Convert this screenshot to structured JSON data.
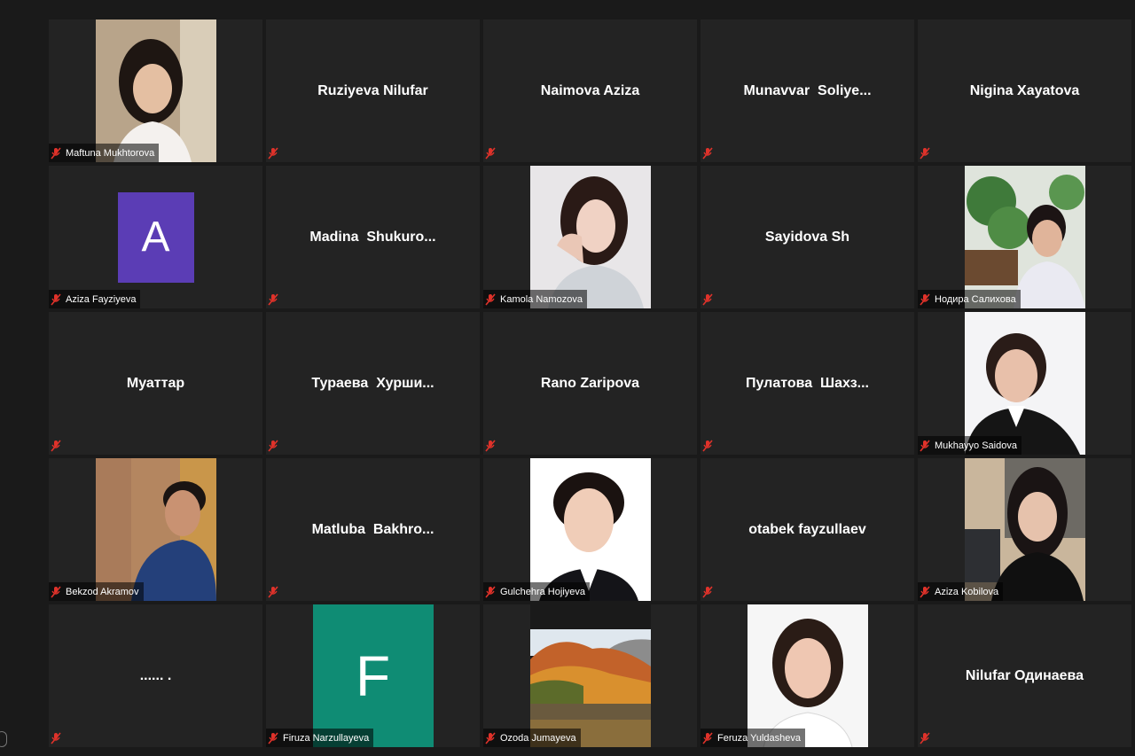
{
  "participants": [
    {
      "name": "Maftuna Mukhtorova",
      "center": "",
      "video": "woman-portrait-1"
    },
    {
      "name": "",
      "center": "Ruziyeva Nilufar"
    },
    {
      "name": "",
      "center": "Naimova Aziza"
    },
    {
      "name": "",
      "center": "Munavvar  Soliye..."
    },
    {
      "name": "",
      "center": "Nigina Xayatova"
    },
    {
      "name": "Aziza Fayziyeva",
      "center": "",
      "avatar_letter": "A",
      "avatar_color": "#5b3db5"
    },
    {
      "name": "",
      "center": "Madina  Shukuro..."
    },
    {
      "name": "Kamola Namozova",
      "center": "",
      "video": "woman-portrait-2"
    },
    {
      "name": "",
      "center": "Sayidova Sh"
    },
    {
      "name": "Нодира Салихова",
      "center": "",
      "video": "woman-portrait-3"
    },
    {
      "name": "",
      "center": "Муаттар"
    },
    {
      "name": "",
      "center": "Тураева  Хурши..."
    },
    {
      "name": "",
      "center": "Rano Zaripova"
    },
    {
      "name": "",
      "center": "Пулатова  Шахз..."
    },
    {
      "name": "Mukhayyo Saidova",
      "center": "",
      "video": "woman-portrait-4"
    },
    {
      "name": "Bekzod Akramov",
      "center": "",
      "video": "man-portrait"
    },
    {
      "name": "",
      "center": "Matluba  Bakhro..."
    },
    {
      "name": "Gulchehra Hojiyeva",
      "center": "",
      "video": "woman-portrait-5"
    },
    {
      "name": "",
      "center": "otabek fayzullaev"
    },
    {
      "name": "Aziza Kobilova",
      "center": "",
      "video": "woman-portrait-6"
    },
    {
      "name": "",
      "center": "...... ."
    },
    {
      "name": "Firuza Narzullayeva",
      "center": "",
      "avatar_letter": "F",
      "avatar_color": "#0f8c74"
    },
    {
      "name": "Ozoda Jumayeva",
      "center": "",
      "video": "autumn-lake-landscape"
    },
    {
      "name": "Feruza Yuldasheva",
      "center": "",
      "video": "woman-portrait-7"
    },
    {
      "name": "",
      "center": "Nilufar Одинаева"
    }
  ],
  "icons": {
    "muted": "muted-mic-icon"
  },
  "colors": {
    "background": "#1a1a1a",
    "tile": "#232323",
    "muted_icon": "#e0322a"
  }
}
